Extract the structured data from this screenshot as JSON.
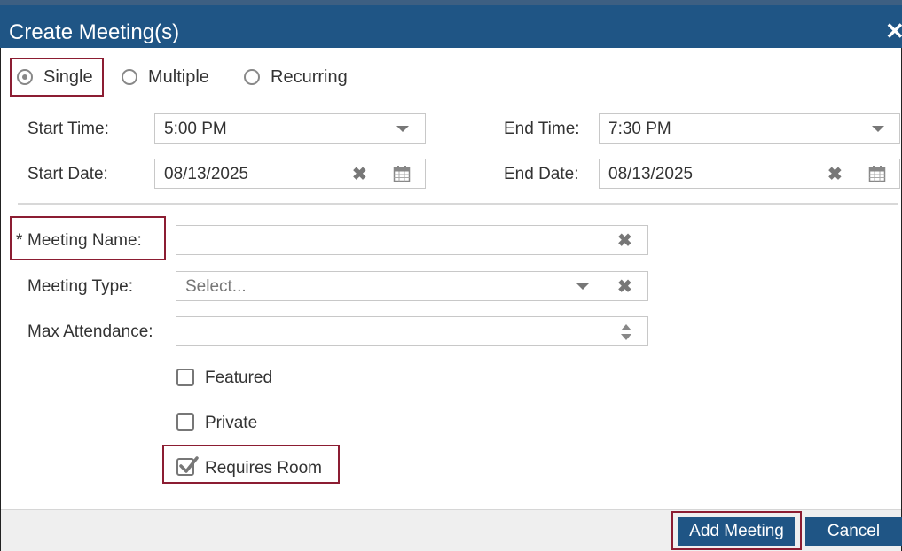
{
  "dialog": {
    "title": "Create Meeting(s)"
  },
  "mode": {
    "options": [
      {
        "label": "Single",
        "selected": true
      },
      {
        "label": "Multiple",
        "selected": false
      },
      {
        "label": "Recurring",
        "selected": false
      }
    ]
  },
  "schedule": {
    "start_time_label": "Start Time:",
    "start_time_value": "5:00 PM",
    "end_time_label": "End Time:",
    "end_time_value": "7:30 PM",
    "start_date_label": "Start Date:",
    "start_date_value": "08/13/2025",
    "end_date_label": "End Date:",
    "end_date_value": "08/13/2025"
  },
  "details": {
    "required_marker": "*",
    "meeting_name_label": "Meeting Name:",
    "meeting_name_value": "",
    "meeting_type_label": "Meeting Type:",
    "meeting_type_placeholder": "Select...",
    "max_attendance_label": "Max Attendance:",
    "max_attendance_value": ""
  },
  "options": [
    {
      "label": "Featured",
      "checked": false
    },
    {
      "label": "Private",
      "checked": false
    },
    {
      "label": "Requires Room",
      "checked": true
    }
  ],
  "footer": {
    "add_label": "Add Meeting",
    "cancel_label": "Cancel"
  },
  "icons": {
    "close": "close-icon",
    "clear": "clear-x-icon",
    "calendar": "calendar-icon",
    "dropdown": "chevron-down-icon",
    "spinner": "spinner-arrows-icon"
  },
  "colors": {
    "header": "#1f5585",
    "highlight": "#8c1d32",
    "button": "#1f5585"
  }
}
